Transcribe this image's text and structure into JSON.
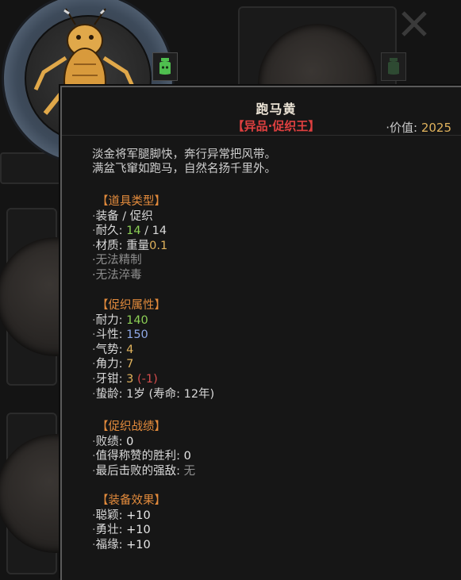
{
  "item": {
    "name": "跑马黄",
    "rarity": "【异品·促织王】",
    "value_label": "·价值:",
    "value": "2025",
    "description": [
      "淡金将军腿脚快，奔行异常把风带。",
      "满盆飞窜如跑马，自然名扬千里外。"
    ]
  },
  "item_type": {
    "title": "【道具类型】",
    "category": "装备 / 促织",
    "durability_label": "耐久:",
    "durability_current": "14",
    "durability_sep": " / ",
    "durability_max": "14",
    "material_label": "材质:",
    "material_value": "重量",
    "material_weight": "0.1",
    "note_refine": "无法精制",
    "note_poison": "无法淬毒"
  },
  "attributes": {
    "title": "【促织属性】",
    "endurance_label": "耐力:",
    "endurance": "140",
    "fighting_label": "斗性:",
    "fighting": "150",
    "momentum_label": "气势:",
    "momentum": "4",
    "horn_label": "角力:",
    "horn": "7",
    "fang_label": "牙钳:",
    "fang": "3",
    "fang_modifier": "(-1)",
    "age_label": "蛰龄:",
    "age": "1岁 (寿命: 12年)"
  },
  "record": {
    "title": "【促织战绩】",
    "losses_label": "败绩:",
    "losses": "0",
    "notable_label": "值得称赞的胜利:",
    "notable": "0",
    "last_foe_label": "最后击败的强敌:",
    "last_foe": "无"
  },
  "equip_effects": {
    "title": "【装备效果】",
    "items": [
      {
        "label": "聪颖:",
        "value": "+10"
      },
      {
        "label": "勇壮:",
        "value": "+10"
      },
      {
        "label": "福缘:",
        "value": "+10"
      }
    ]
  },
  "colors": {
    "section_title": "#e38b3c",
    "rarity_red": "#e04040",
    "value_gold": "#e0b25c",
    "stat_green": "#8ccf55",
    "stat_blue": "#8fa8e6"
  }
}
